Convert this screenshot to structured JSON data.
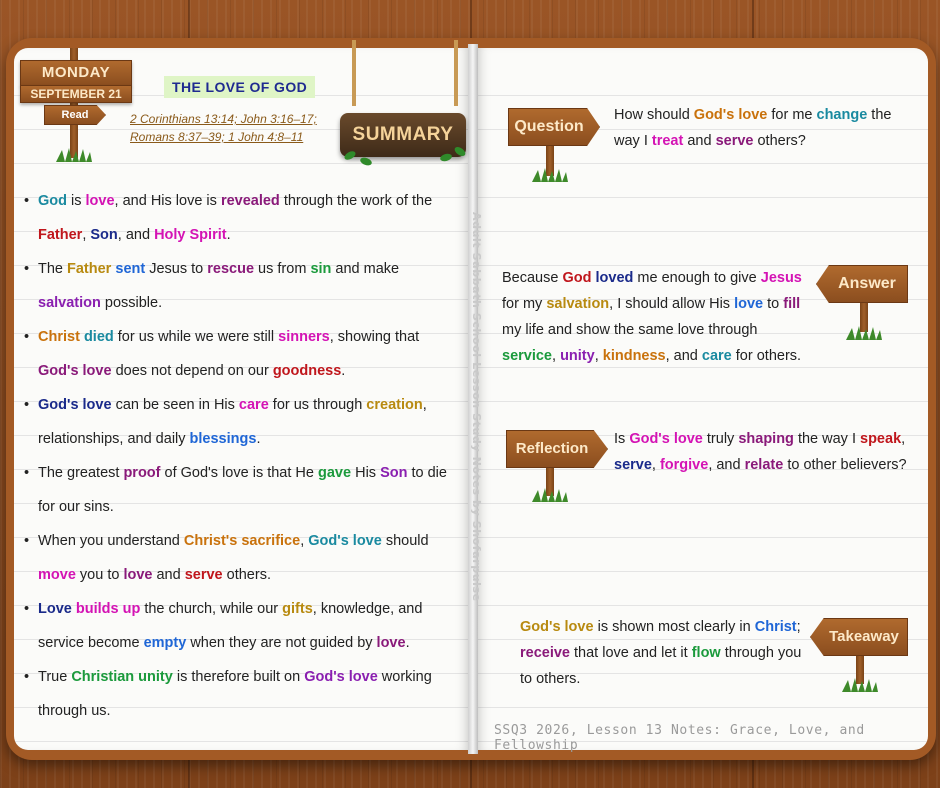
{
  "header": {
    "day": "MONDAY",
    "date": "SEPTEMBER 21",
    "read_label": "Read",
    "topic": "THE LOVE OF GOD",
    "references_line1": "2 Corinthians 13:14; John 3:16–17;",
    "references_line2": "Romans 8:37–39; 1 John 4:8–11",
    "summary_label": "SUMMARY"
  },
  "spine_label": "Adult Sabbath School Lesson Study Notes by Shofarpulse",
  "bullets": [
    [
      [
        "God",
        "teal"
      ],
      [
        " is ",
        ""
      ],
      [
        "love",
        "mag"
      ],
      [
        ", and His love is ",
        ""
      ],
      [
        "revealed",
        "plum"
      ],
      [
        " through the work of the ",
        ""
      ],
      [
        "Father",
        "crim"
      ],
      [
        ", ",
        ""
      ],
      [
        "Son",
        "navy"
      ],
      [
        ", and ",
        ""
      ],
      [
        "Holy Spirit",
        "mag"
      ],
      [
        ".",
        ""
      ]
    ],
    [
      [
        "The ",
        ""
      ],
      [
        "Father",
        "gold"
      ],
      [
        " ",
        ""
      ],
      [
        "sent",
        "blue"
      ],
      [
        " Jesus to ",
        ""
      ],
      [
        "rescue",
        "plum"
      ],
      [
        " us from ",
        ""
      ],
      [
        "sin",
        "green"
      ],
      [
        " and make ",
        ""
      ],
      [
        "salvation",
        "purple"
      ],
      [
        " possible.",
        ""
      ]
    ],
    [
      [
        "Christ",
        "orange"
      ],
      [
        " ",
        ""
      ],
      [
        "died",
        "teal"
      ],
      [
        " for us while we were still ",
        ""
      ],
      [
        "sinners",
        "mag"
      ],
      [
        ", showing that ",
        ""
      ],
      [
        "God's love",
        "plum"
      ],
      [
        " does not depend on our ",
        ""
      ],
      [
        "goodness",
        "crim"
      ],
      [
        ".",
        ""
      ]
    ],
    [
      [
        "God's love",
        "navy"
      ],
      [
        " can be seen in His ",
        ""
      ],
      [
        "care",
        "mag"
      ],
      [
        " for us through ",
        ""
      ],
      [
        "creation",
        "gold"
      ],
      [
        ", relationships, and daily ",
        ""
      ],
      [
        "blessings",
        "blue"
      ],
      [
        ".",
        ""
      ]
    ],
    [
      [
        "The greatest ",
        ""
      ],
      [
        "proof",
        "plum"
      ],
      [
        " of God's love is that He ",
        ""
      ],
      [
        "gave",
        "green"
      ],
      [
        " His ",
        ""
      ],
      [
        "Son",
        "purple"
      ],
      [
        " to die for our sins.",
        ""
      ]
    ],
    [
      [
        "When you understand ",
        ""
      ],
      [
        "Christ's sacrifice",
        "orange"
      ],
      [
        ", ",
        ""
      ],
      [
        "God's love",
        "teal"
      ],
      [
        " should ",
        ""
      ],
      [
        "move",
        "mag"
      ],
      [
        " you to ",
        ""
      ],
      [
        "love",
        "plum"
      ],
      [
        " and ",
        ""
      ],
      [
        "serve",
        "crim"
      ],
      [
        " others.",
        ""
      ]
    ],
    [
      [
        "Love",
        "navy"
      ],
      [
        " ",
        ""
      ],
      [
        "builds up",
        "mag"
      ],
      [
        " the church, while our ",
        ""
      ],
      [
        "gifts",
        "gold"
      ],
      [
        ", knowledge, and service become ",
        ""
      ],
      [
        "empty",
        "blue"
      ],
      [
        " when they are not guided by ",
        ""
      ],
      [
        "love",
        "plum"
      ],
      [
        ".",
        ""
      ]
    ],
    [
      [
        "True ",
        ""
      ],
      [
        "Christian unity",
        "green"
      ],
      [
        " is therefore built on ",
        ""
      ],
      [
        "God's love",
        "purple"
      ],
      [
        " working through us.",
        ""
      ]
    ]
  ],
  "sections": {
    "question": {
      "label": "Question",
      "parts": [
        [
          "How should ",
          ""
        ],
        [
          "God's love",
          "orange"
        ],
        [
          " for me ",
          ""
        ],
        [
          "change",
          "teal"
        ],
        [
          " the way I ",
          ""
        ],
        [
          "treat",
          "mag"
        ],
        [
          " and ",
          ""
        ],
        [
          "serve",
          "plum"
        ],
        [
          " others?",
          ""
        ]
      ]
    },
    "answer": {
      "label": "Answer",
      "parts": [
        [
          "Because ",
          ""
        ],
        [
          "God",
          "crim"
        ],
        [
          " ",
          ""
        ],
        [
          "loved",
          "navy"
        ],
        [
          " me enough to give ",
          ""
        ],
        [
          "Jesus",
          "mag"
        ],
        [
          " for my ",
          ""
        ],
        [
          "salvation",
          "gold"
        ],
        [
          ", I should allow His ",
          ""
        ],
        [
          "love",
          "blue"
        ],
        [
          " to ",
          ""
        ],
        [
          "fill",
          "plum"
        ],
        [
          " my life and show the same love through ",
          ""
        ],
        [
          "service",
          "green"
        ],
        [
          ", ",
          ""
        ],
        [
          "unity",
          "purple"
        ],
        [
          ", ",
          ""
        ],
        [
          "kindness",
          "orange"
        ],
        [
          ", and ",
          ""
        ],
        [
          "care",
          "teal"
        ],
        [
          " for others.",
          ""
        ]
      ]
    },
    "reflection": {
      "label": "Reflection",
      "parts": [
        [
          "Is ",
          ""
        ],
        [
          "God's love",
          "mag"
        ],
        [
          " truly ",
          ""
        ],
        [
          "shaping",
          "plum"
        ],
        [
          " the way I ",
          ""
        ],
        [
          "speak",
          "crim"
        ],
        [
          ", ",
          ""
        ],
        [
          "serve",
          "navy"
        ],
        [
          ", ",
          ""
        ],
        [
          "forgive",
          "mag"
        ],
        [
          ", and ",
          ""
        ],
        [
          "relate",
          "plum"
        ],
        [
          " to other believers?",
          ""
        ]
      ]
    },
    "takeaway": {
      "label": "Takeaway",
      "parts": [
        [
          "God's love",
          "gold"
        ],
        [
          " is shown most clearly in ",
          ""
        ],
        [
          "Christ",
          "blue"
        ],
        [
          "; ",
          ""
        ],
        [
          "receive",
          "plum"
        ],
        [
          " that love and let it ",
          ""
        ],
        [
          "flow",
          "green"
        ],
        [
          " through you to others.",
          ""
        ]
      ]
    }
  },
  "footer": "SSQ3 2026, Lesson 13 Notes: Grace, Love, and Fellowship",
  "colors": {
    "wood": "#8b4e1f",
    "page": "#fbfbf9",
    "teal": "#1a8aa0",
    "magenta": "#d413b4",
    "crimson": "#c0161c",
    "navy": "#1a2a8a",
    "orange": "#c9720c",
    "blue": "#1f66d6",
    "green": "#1b9a3c",
    "purple": "#8a1fb0",
    "gold": "#b88a10",
    "plum": "#8a1a7a"
  }
}
